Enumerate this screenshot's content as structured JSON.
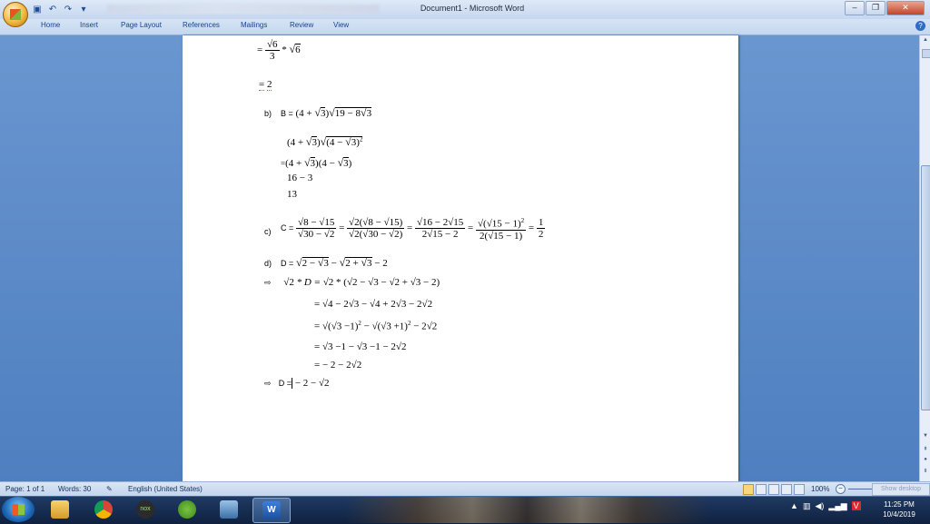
{
  "window": {
    "title": "Document1 - Microsoft Word"
  },
  "ribbon": {
    "tabs": [
      "Home",
      "Insert",
      "Page Layout",
      "References",
      "Mailings",
      "Review",
      "View"
    ]
  },
  "document": {
    "line1": {
      "eq": "=",
      "num": "6",
      "den": "3",
      "op": "*",
      "rad": "6"
    },
    "line2": {
      "eq": "=",
      "val": "2"
    },
    "b": {
      "label": "b)",
      "name": "B =",
      "expr_a": "(4 + ",
      "rad_a": "3",
      "expr_b": ")",
      "rad_b": "19 − 8",
      "rad_c": "3"
    },
    "b_steps": {
      "s1a": "(4 + ",
      "s1r": "3",
      "s1b": ")",
      "s1c": "(4 − ",
      "s1d": "3",
      "s1e": ")",
      "s1sq": "2",
      "s2eq": "=",
      "s2a": "(4 + ",
      "s2r": "3",
      "s2b": ")(4 − ",
      "s2r2": "3",
      "s2c": ")",
      "s3": "16 − 3",
      "s4": "13"
    },
    "c": {
      "label": "c)",
      "name": "C =",
      "f1n1": "8 − ",
      "f1n2": "15",
      "f1d1": "30 − ",
      "f1d2": "2",
      "f2n1": "2",
      "f2n2": "(",
      "f2n3": "8 − ",
      "f2n4": "15",
      "f2n5": ")",
      "f2d1": "2",
      "f2d2": "(",
      "f2d3": "30 − ",
      "f2d4": "2",
      "f2d5": ")",
      "f3n1": "16 − 2",
      "f3n2": "15",
      "f3d1": "2",
      "f3d2": "15",
      "f3d3": " − 2",
      "f4n1": "(",
      "f4n2": "15",
      "f4n3": " − 1)",
      "f4sq": "2",
      "f4d1": "2(",
      "f4d2": "15",
      "f4d3": " − 1)",
      "f5n": "1",
      "f5d": "2",
      "eq": "="
    },
    "d": {
      "label": "d)",
      "name": "D =",
      "r1": "2 − ",
      "r1b": "3",
      "minus": " − ",
      "r2": "2 + ",
      "r2b": "3",
      "tail": " − 2"
    },
    "d_steps": {
      "arrow": "⇨",
      "s0a": "2",
      "s0b": " * D = ",
      "s0c": "2",
      "s0d": " * (",
      "s0e": "2 − ",
      "s0f": "3",
      "s0g": " − ",
      "s0h": "2 + ",
      "s0i": "3",
      "s0j": " − 2)",
      "s1eq": "=",
      "s1a": "4 − 2",
      "s1b": "3",
      "s1c": " − ",
      "s1d": "4 + 2",
      "s1e": "3",
      "s1f": " − 2",
      "s1g": "2",
      "s2eq": "=",
      "s2a": "(",
      "s2b": "3",
      "s2c": " −1)",
      "s2sq": "2",
      "s2d": " − ",
      "s2e": "(",
      "s2f": "3",
      "s2g": " +1)",
      "s2sq2": "2",
      "s2h": " − 2",
      "s2i": "2",
      "s3eq": "=",
      "s3a": "3",
      "s3b": " −1 − ",
      "s3c": "3",
      "s3d": " −1 − 2",
      "s3e": "2",
      "s4eq": "=",
      "s4a": " − 2 − 2",
      "s4b": "2",
      "final_name": "D =",
      "final_a": " − 2 − ",
      "final_b": "2"
    }
  },
  "status": {
    "page": "Page: 1 of 1",
    "words": "Words: 30",
    "language": "English (United States)",
    "zoom": "100%"
  },
  "show_desktop": "Show desktop",
  "clock": {
    "time": "11:25 PM",
    "date": "10/4/2019"
  }
}
